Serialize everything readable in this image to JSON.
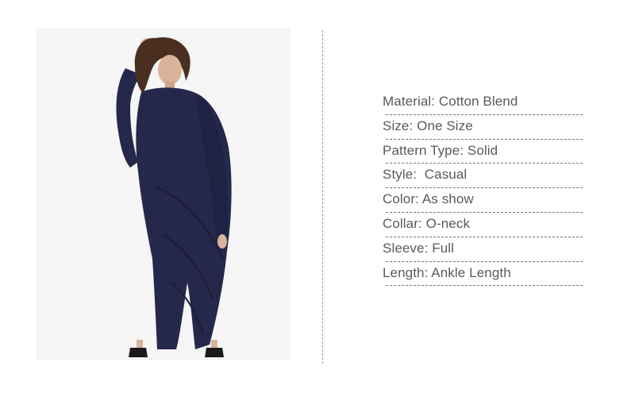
{
  "product_image": {
    "alt_icon": "dress-model-photo",
    "colors": {
      "background": "#f5f5f5",
      "dress": "#25284a",
      "hair": "#4a2e1f",
      "skin": "#d9b39a",
      "shoes": "#1a1a1a"
    }
  },
  "specs": [
    {
      "text": "Material: Cotton Blend"
    },
    {
      "text": "Size: One Size"
    },
    {
      "text": "Pattern Type: Solid"
    },
    {
      "text": "Style:  Casual"
    },
    {
      "text": "Color: As show"
    },
    {
      "text": "Collar: O-neck"
    },
    {
      "text": "Sleeve: Full"
    },
    {
      "text": "Length: Ankle Length"
    }
  ]
}
